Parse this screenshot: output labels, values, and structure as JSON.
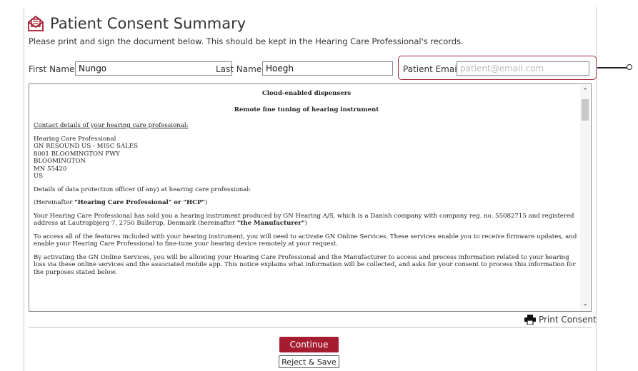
{
  "header": {
    "title": "Patient Consent Summary",
    "icon": "envelope-document-icon",
    "accent_color": "#a51c30",
    "instructions": "Please print and sign the document below. This should be kept in the Hearing Care Professional's records."
  },
  "fields": {
    "first_name_label": "First Name:",
    "first_name_value": "Nungo",
    "last_name_label": "Last Name:",
    "last_name_value": "Hoegh",
    "email_label": "Patient Email:",
    "email_placeholder": "patient@email.com"
  },
  "document": {
    "heading1": "Cloud-enabled dispensers",
    "heading2": "Remote fine tuning of hearing instrument",
    "contact_heading": "Contact details of your hearing care professional:",
    "address": [
      "Hearing Care Professional",
      "GN RESOUND US - MISC SALES",
      "8001 BLOOMINGTON FWY",
      "BLOOMINGTON",
      "MN 55420",
      "US"
    ],
    "dpo_line": "Details of data protection officer (if any) at hearing care professional:",
    "hereinafter_prefix": "(Hereinafter ",
    "hereinafter_bold": "\"Hearing Care Professional\" or \"HCP\"",
    "hereinafter_suffix": ")",
    "para1_text": "Your Hearing Care Professional has sold you a hearing instrument produced by GN Hearing A/S, which is a Danish company with company reg. no. 55082715 and registered address at Lautrupbjerg 7, 2750 Ballerup, Denmark (hereinafter ",
    "para1_bold": "\"the Manufacturer\"",
    "para1_suffix": ")",
    "para2": "To access all of the features included with your hearing instrument, you will need to activate GN Online Services. These services enable you to receive firmware updates, and enable your Hearing Care Professional to fine-tune your hearing device remotely at your request.",
    "para3": "By activating the GN Online Services, you will be allowing your Hearing Care Professional and the Manufacturer to access and process information related to your hearing loss via these online services and the associated mobile app. This notice explains what information will be collected, and asks for your consent to process this information for the purposes stated below."
  },
  "actions": {
    "print_label": "Print Consent",
    "print_icon": "printer-icon",
    "continue_label": "Continue",
    "reject_label": "Reject & Save"
  }
}
